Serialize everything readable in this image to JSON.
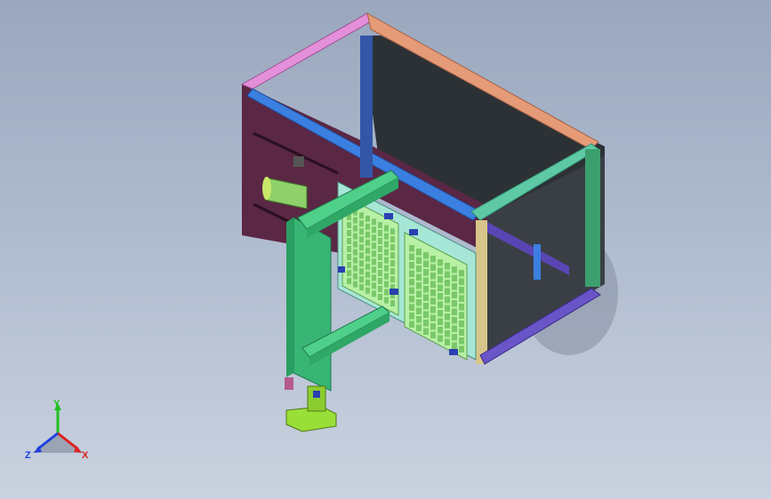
{
  "viewport": {
    "background_top": "#9aa7bd",
    "background_bottom": "#c9d2df"
  },
  "model": {
    "description_icon": "cad-assembly-icon",
    "colors": {
      "frame_pink": "#e48fd9",
      "frame_orange": "#e59b78",
      "frame_teal": "#5fc9a6",
      "frame_blue": "#3b7fe0",
      "frame_purple": "#6a55c8",
      "panel_maroon": "#5e2a48",
      "panel_dark": "#2c3136",
      "bracket_green": "#38b574",
      "tray_light_green": "#b8f0a6",
      "base_yellow_green": "#9ade38"
    }
  },
  "triad": {
    "x_label": "X",
    "y_label": "Y",
    "z_label": "Z",
    "x_color": "#e02020",
    "y_color": "#20c020",
    "z_color": "#2040e0"
  }
}
